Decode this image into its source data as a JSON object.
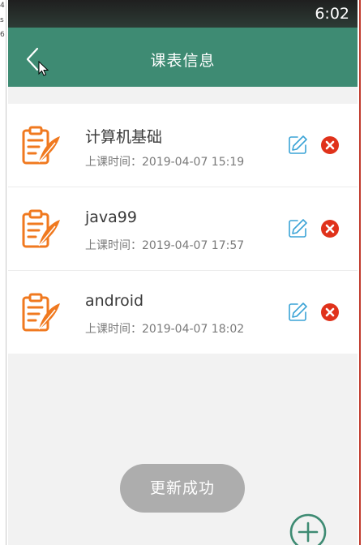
{
  "stray_chars": [
    "4",
    "s",
    "6"
  ],
  "status_bar": {
    "time": "6:02"
  },
  "app_bar": {
    "title": "课表信息",
    "back_icon": "chevron-left-icon"
  },
  "courses": [
    {
      "name": "计算机基础",
      "time_label": "上课时间：",
      "time": "2019-04-07 15:19"
    },
    {
      "name": "java99",
      "time_label": "上课时间：",
      "time": "2019-04-07 17:57"
    },
    {
      "name": "android",
      "time_label": "上课时间：",
      "time": "2019-04-07 18:02"
    }
  ],
  "toast": {
    "text": "更新成功"
  },
  "colors": {
    "app_bar": "#3e8b73",
    "course_icon": "#f0791f",
    "edit_icon": "#3aa3d6",
    "delete_icon": "#e0321b",
    "fab": "#3e8b73",
    "toast_bg": "#adadad"
  },
  "icons": {
    "course": "clipboard-feather-icon",
    "edit": "edit-icon",
    "delete": "delete-icon",
    "add": "add-circle-icon"
  }
}
